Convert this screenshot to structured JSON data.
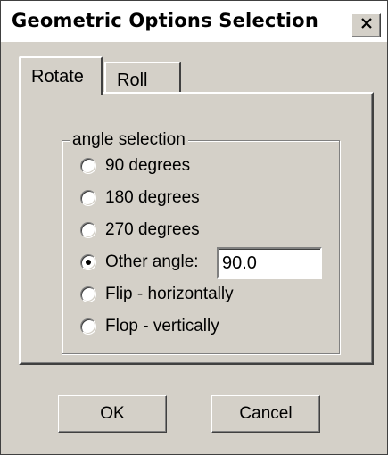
{
  "window": {
    "title": "Geometric Options Selection"
  },
  "tabs": [
    {
      "label": "Rotate",
      "selected": true
    },
    {
      "label": "Roll",
      "selected": false
    }
  ],
  "group": {
    "title": "angle selection",
    "options": [
      {
        "label": "90 degrees",
        "checked": false
      },
      {
        "label": "180 degrees",
        "checked": false
      },
      {
        "label": "270 degrees",
        "checked": false
      },
      {
        "label": "Other angle:",
        "checked": true
      },
      {
        "label": "Flip - horizontally",
        "checked": false
      },
      {
        "label": "Flop - vertically",
        "checked": false
      }
    ]
  },
  "other_angle_value": "90.0",
  "buttons": {
    "ok": "OK",
    "cancel": "Cancel"
  },
  "icons": {
    "close": "close-icon"
  }
}
